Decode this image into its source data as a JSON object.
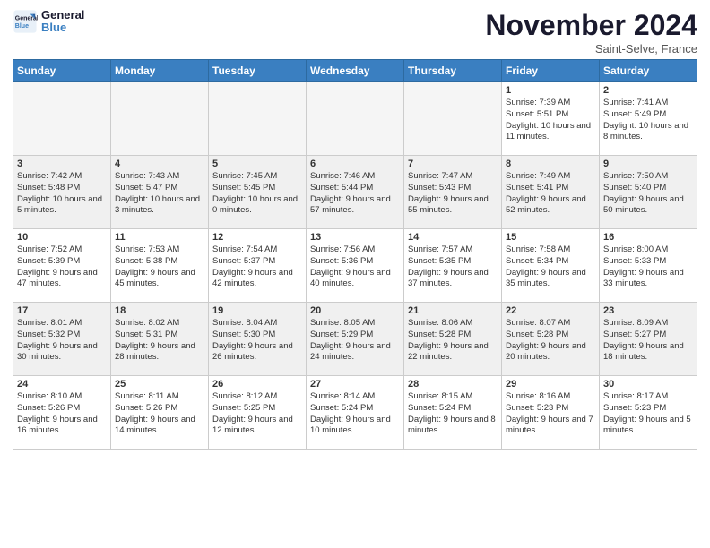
{
  "header": {
    "logo_line1": "General",
    "logo_line2": "Blue",
    "month": "November 2024",
    "location": "Saint-Selve, France"
  },
  "weekdays": [
    "Sunday",
    "Monday",
    "Tuesday",
    "Wednesday",
    "Thursday",
    "Friday",
    "Saturday"
  ],
  "weeks": [
    [
      {
        "day": "",
        "info": ""
      },
      {
        "day": "",
        "info": ""
      },
      {
        "day": "",
        "info": ""
      },
      {
        "day": "",
        "info": ""
      },
      {
        "day": "",
        "info": ""
      },
      {
        "day": "1",
        "info": "Sunrise: 7:39 AM\nSunset: 5:51 PM\nDaylight: 10 hours and 11 minutes."
      },
      {
        "day": "2",
        "info": "Sunrise: 7:41 AM\nSunset: 5:49 PM\nDaylight: 10 hours and 8 minutes."
      }
    ],
    [
      {
        "day": "3",
        "info": "Sunrise: 7:42 AM\nSunset: 5:48 PM\nDaylight: 10 hours and 5 minutes."
      },
      {
        "day": "4",
        "info": "Sunrise: 7:43 AM\nSunset: 5:47 PM\nDaylight: 10 hours and 3 minutes."
      },
      {
        "day": "5",
        "info": "Sunrise: 7:45 AM\nSunset: 5:45 PM\nDaylight: 10 hours and 0 minutes."
      },
      {
        "day": "6",
        "info": "Sunrise: 7:46 AM\nSunset: 5:44 PM\nDaylight: 9 hours and 57 minutes."
      },
      {
        "day": "7",
        "info": "Sunrise: 7:47 AM\nSunset: 5:43 PM\nDaylight: 9 hours and 55 minutes."
      },
      {
        "day": "8",
        "info": "Sunrise: 7:49 AM\nSunset: 5:41 PM\nDaylight: 9 hours and 52 minutes."
      },
      {
        "day": "9",
        "info": "Sunrise: 7:50 AM\nSunset: 5:40 PM\nDaylight: 9 hours and 50 minutes."
      }
    ],
    [
      {
        "day": "10",
        "info": "Sunrise: 7:52 AM\nSunset: 5:39 PM\nDaylight: 9 hours and 47 minutes."
      },
      {
        "day": "11",
        "info": "Sunrise: 7:53 AM\nSunset: 5:38 PM\nDaylight: 9 hours and 45 minutes."
      },
      {
        "day": "12",
        "info": "Sunrise: 7:54 AM\nSunset: 5:37 PM\nDaylight: 9 hours and 42 minutes."
      },
      {
        "day": "13",
        "info": "Sunrise: 7:56 AM\nSunset: 5:36 PM\nDaylight: 9 hours and 40 minutes."
      },
      {
        "day": "14",
        "info": "Sunrise: 7:57 AM\nSunset: 5:35 PM\nDaylight: 9 hours and 37 minutes."
      },
      {
        "day": "15",
        "info": "Sunrise: 7:58 AM\nSunset: 5:34 PM\nDaylight: 9 hours and 35 minutes."
      },
      {
        "day": "16",
        "info": "Sunrise: 8:00 AM\nSunset: 5:33 PM\nDaylight: 9 hours and 33 minutes."
      }
    ],
    [
      {
        "day": "17",
        "info": "Sunrise: 8:01 AM\nSunset: 5:32 PM\nDaylight: 9 hours and 30 minutes."
      },
      {
        "day": "18",
        "info": "Sunrise: 8:02 AM\nSunset: 5:31 PM\nDaylight: 9 hours and 28 minutes."
      },
      {
        "day": "19",
        "info": "Sunrise: 8:04 AM\nSunset: 5:30 PM\nDaylight: 9 hours and 26 minutes."
      },
      {
        "day": "20",
        "info": "Sunrise: 8:05 AM\nSunset: 5:29 PM\nDaylight: 9 hours and 24 minutes."
      },
      {
        "day": "21",
        "info": "Sunrise: 8:06 AM\nSunset: 5:28 PM\nDaylight: 9 hours and 22 minutes."
      },
      {
        "day": "22",
        "info": "Sunrise: 8:07 AM\nSunset: 5:28 PM\nDaylight: 9 hours and 20 minutes."
      },
      {
        "day": "23",
        "info": "Sunrise: 8:09 AM\nSunset: 5:27 PM\nDaylight: 9 hours and 18 minutes."
      }
    ],
    [
      {
        "day": "24",
        "info": "Sunrise: 8:10 AM\nSunset: 5:26 PM\nDaylight: 9 hours and 16 minutes."
      },
      {
        "day": "25",
        "info": "Sunrise: 8:11 AM\nSunset: 5:26 PM\nDaylight: 9 hours and 14 minutes."
      },
      {
        "day": "26",
        "info": "Sunrise: 8:12 AM\nSunset: 5:25 PM\nDaylight: 9 hours and 12 minutes."
      },
      {
        "day": "27",
        "info": "Sunrise: 8:14 AM\nSunset: 5:24 PM\nDaylight: 9 hours and 10 minutes."
      },
      {
        "day": "28",
        "info": "Sunrise: 8:15 AM\nSunset: 5:24 PM\nDaylight: 9 hours and 8 minutes."
      },
      {
        "day": "29",
        "info": "Sunrise: 8:16 AM\nSunset: 5:23 PM\nDaylight: 9 hours and 7 minutes."
      },
      {
        "day": "30",
        "info": "Sunrise: 8:17 AM\nSunset: 5:23 PM\nDaylight: 9 hours and 5 minutes."
      }
    ]
  ]
}
